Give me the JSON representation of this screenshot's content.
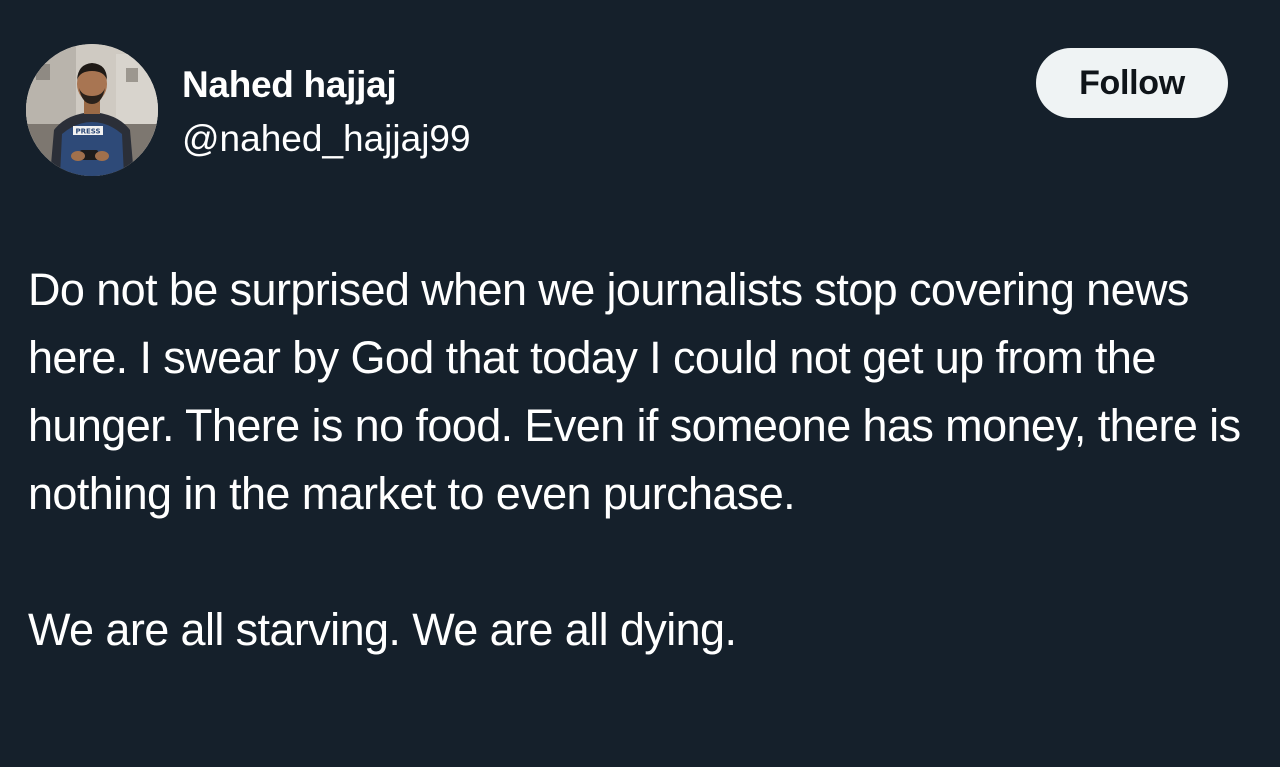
{
  "author": {
    "display_name": "Nahed hajjaj",
    "handle": "@nahed_hajjaj99",
    "avatar_badge": "PRESS"
  },
  "actions": {
    "follow_label": "Follow"
  },
  "tweet": {
    "paragraphs": [
      "Do not be surprised when we journalists stop covering news here. I swear by God that today I could not get up from the hunger. There is no food. Even if someone has money, there is nothing in the market to even purchase.",
      "We are all starving. We are all dying."
    ]
  },
  "colors": {
    "background": "#15202b",
    "text": "#ffffff",
    "follow_bg": "#eff3f4",
    "follow_text": "#0f1419"
  }
}
